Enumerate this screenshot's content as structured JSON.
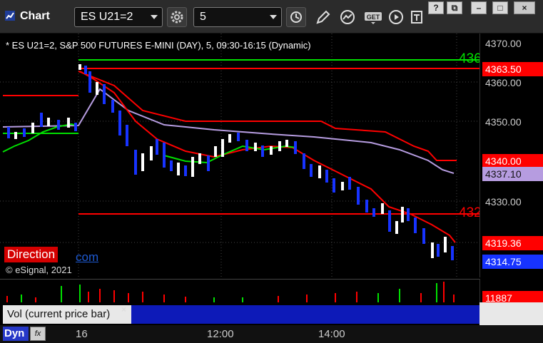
{
  "window": {
    "app_title": "Chart",
    "symbol": "ES U21=2",
    "interval": "5",
    "controls": {
      "help": "?",
      "restore": "⧉",
      "minimize": "–",
      "maximize": "□",
      "close": "×"
    }
  },
  "chart": {
    "header": "* ES U21=2, S&P 500 FUTURES E-MINI (DAY), 5, 09:30-16:15 (Dynamic)",
    "y_ticks": [
      "4370.00",
      "4360.00",
      "4350.00",
      "4330.00"
    ],
    "labels": {
      "green_line_label": "436",
      "red_line_label": "432",
      "price_tag_1": "4363.50",
      "price_tag_2": "4340.00",
      "price_tag_3": "4337.10",
      "price_tag_4": "4319.36",
      "price_tag_5": "4314.75"
    },
    "direction": "Direction",
    "link": "com",
    "copyright": "© eSignal, 2021",
    "colors": {
      "green_line": "#00e000",
      "red_line": "#ff0000",
      "purple_line": "#b69ce0",
      "candle_blue": "#1733ff",
      "candle_white": "#ffffff"
    }
  },
  "volume": {
    "label": "Vol (current price bar)",
    "value": "11887",
    "close": "×"
  },
  "footer": {
    "dyn": "Dyn",
    "fx": "fx",
    "time_labels": [
      "16",
      "12:00",
      "14:00"
    ]
  }
}
